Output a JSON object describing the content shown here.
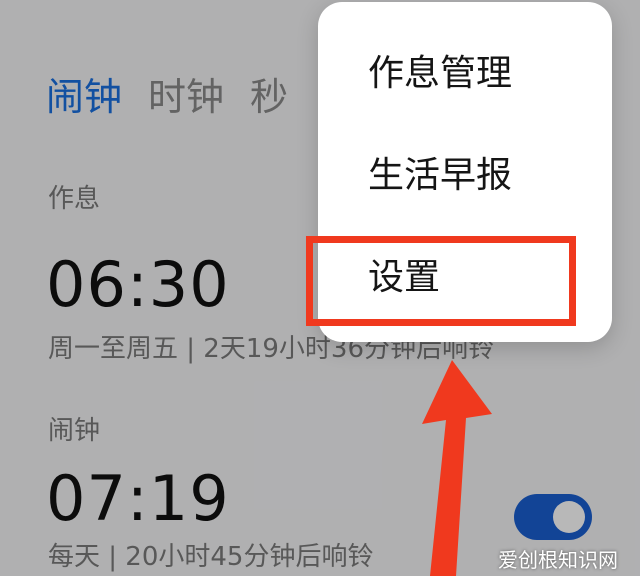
{
  "tabs": [
    {
      "label": "闹钟"
    },
    {
      "label": "时钟"
    },
    {
      "label": "秒"
    }
  ],
  "sections": {
    "rest": {
      "title": "作息",
      "time": "06:30",
      "desc": "周一至周五 | 2天19小时36分钟后响铃"
    },
    "alarm": {
      "title": "闹钟",
      "time": "07:19",
      "desc": "每天 | 20小时45分钟后响铃",
      "enabled": true
    }
  },
  "menu": {
    "items": [
      {
        "label": "作息管理"
      },
      {
        "label": "生活早报"
      },
      {
        "label": "设置"
      }
    ],
    "highlighted_index": 2
  },
  "watermark": "爱创根知识网",
  "colors": {
    "accent": "#1a6fe0",
    "toggle_on": "#1a5fd0",
    "highlight": "#f0391e"
  }
}
